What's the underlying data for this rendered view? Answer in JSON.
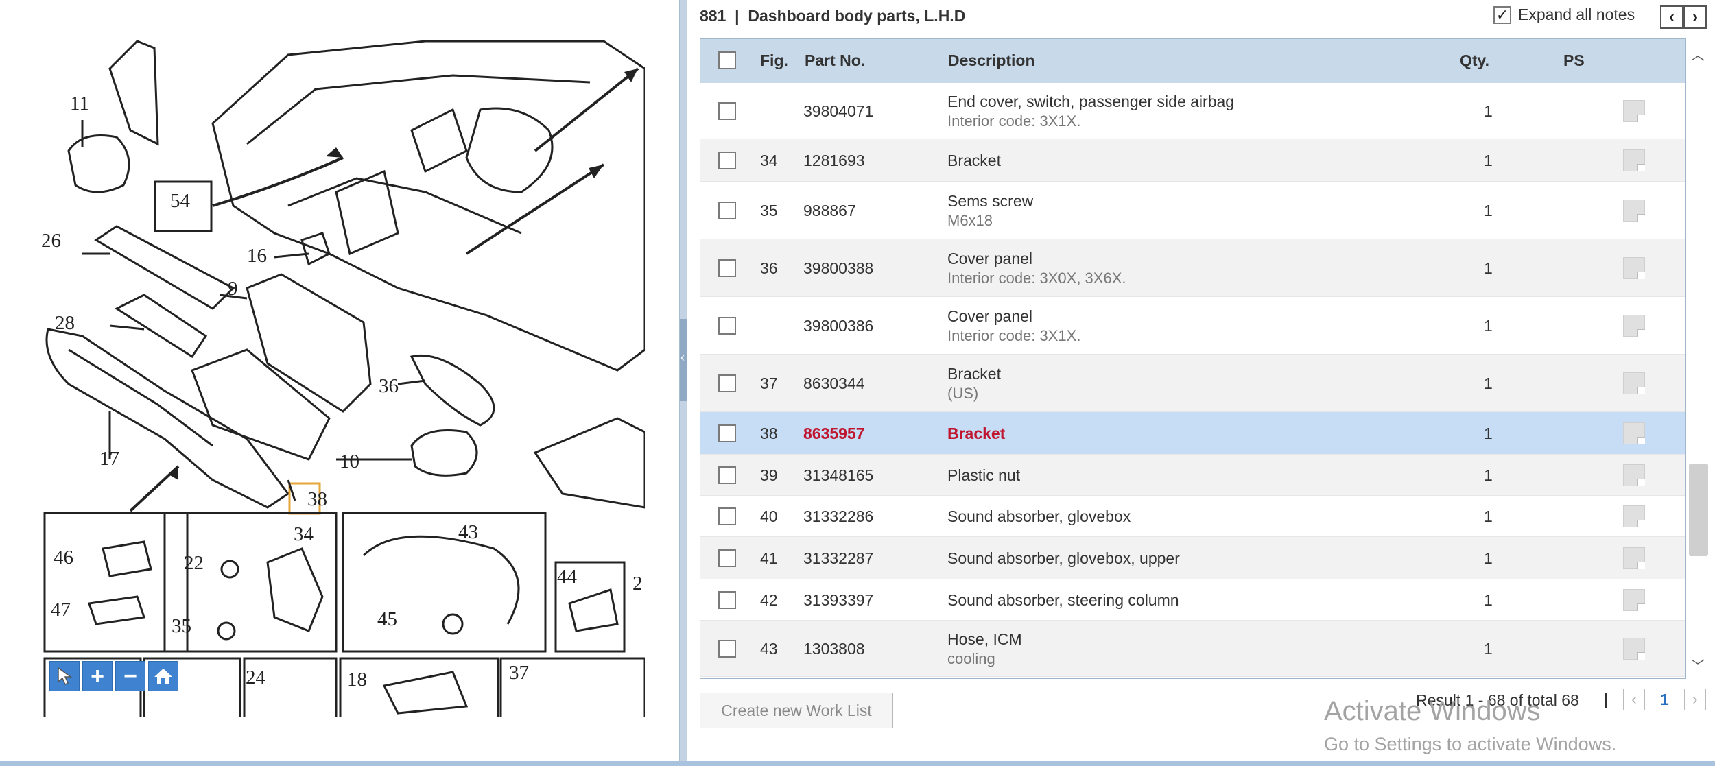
{
  "diagram": {
    "callouts": {
      "c11": "11",
      "c54": "54",
      "c26": "26",
      "c16": "16",
      "c9": "9",
      "c28": "28",
      "c36": "36",
      "c17": "17",
      "c10": "10",
      "c38": "38",
      "c34": "34",
      "c43": "43",
      "c46": "46",
      "c22": "22",
      "c44": "44",
      "c47": "47",
      "c35": "35",
      "c45": "45",
      "c24": "24",
      "c18": "18",
      "c37": "37",
      "c2": "2"
    },
    "tools": [
      "pointer-icon",
      "zoom-in-icon",
      "zoom-out-icon",
      "home-icon"
    ]
  },
  "header": {
    "group_number": "881",
    "separator": "|",
    "group_title": "Dashboard body parts, L.H.D",
    "expand_checked": "✓",
    "expand_label": "Expand all notes",
    "prev_arrow": "‹",
    "next_arrow": "›"
  },
  "table": {
    "columns": {
      "fig": "Fig.",
      "part_no": "Part No.",
      "description": "Description",
      "qty": "Qty.",
      "ps": "PS"
    },
    "rows": [
      {
        "fig": "",
        "part_no": "39804071",
        "desc": "End cover, switch, passenger side airbag",
        "sub": "Interior code: 3X1X.",
        "qty": "1"
      },
      {
        "fig": "34",
        "part_no": "1281693",
        "desc": "Bracket",
        "sub": "",
        "qty": "1"
      },
      {
        "fig": "35",
        "part_no": "988867",
        "desc": "Sems screw",
        "sub": "M6x18",
        "qty": "1"
      },
      {
        "fig": "36",
        "part_no": "39800388",
        "desc": "Cover panel",
        "sub": "Interior code: 3X0X, 3X6X.",
        "qty": "1"
      },
      {
        "fig": "",
        "part_no": "39800386",
        "desc": "Cover panel",
        "sub": "Interior code: 3X1X.",
        "qty": "1"
      },
      {
        "fig": "37",
        "part_no": "8630344",
        "desc": "Bracket",
        "sub": "(US)",
        "qty": "1"
      },
      {
        "fig": "38",
        "part_no": "8635957",
        "desc": "Bracket",
        "sub": "",
        "qty": "1",
        "selected": true
      },
      {
        "fig": "39",
        "part_no": "31348165",
        "desc": "Plastic nut",
        "sub": "",
        "qty": "1"
      },
      {
        "fig": "40",
        "part_no": "31332286",
        "desc": "Sound absorber, glovebox",
        "sub": "",
        "qty": "1"
      },
      {
        "fig": "41",
        "part_no": "31332287",
        "desc": "Sound absorber, glovebox, upper",
        "sub": "",
        "qty": "1"
      },
      {
        "fig": "42",
        "part_no": "31393397",
        "desc": "Sound absorber, steering column",
        "sub": "",
        "qty": "1"
      },
      {
        "fig": "43",
        "part_no": "1303808",
        "desc": "Hose, ICM",
        "sub": "cooling",
        "qty": "1"
      }
    ]
  },
  "footer": {
    "worklist_button": "Create new Work List",
    "result_text": "Result 1 - 68 of total 68",
    "pager_separator": "|",
    "page_prev": "‹",
    "page_number": "1",
    "page_next": "›"
  },
  "watermark": {
    "title": "Activate Windows",
    "subtitle": "Go to Settings to activate Windows."
  },
  "colors": {
    "header_bg": "#c8d9ea",
    "selected_row_bg": "#c7ddf5",
    "selected_text": "#c0152f",
    "tool_button": "#3f82cf",
    "page_link": "#2a6fc0"
  }
}
